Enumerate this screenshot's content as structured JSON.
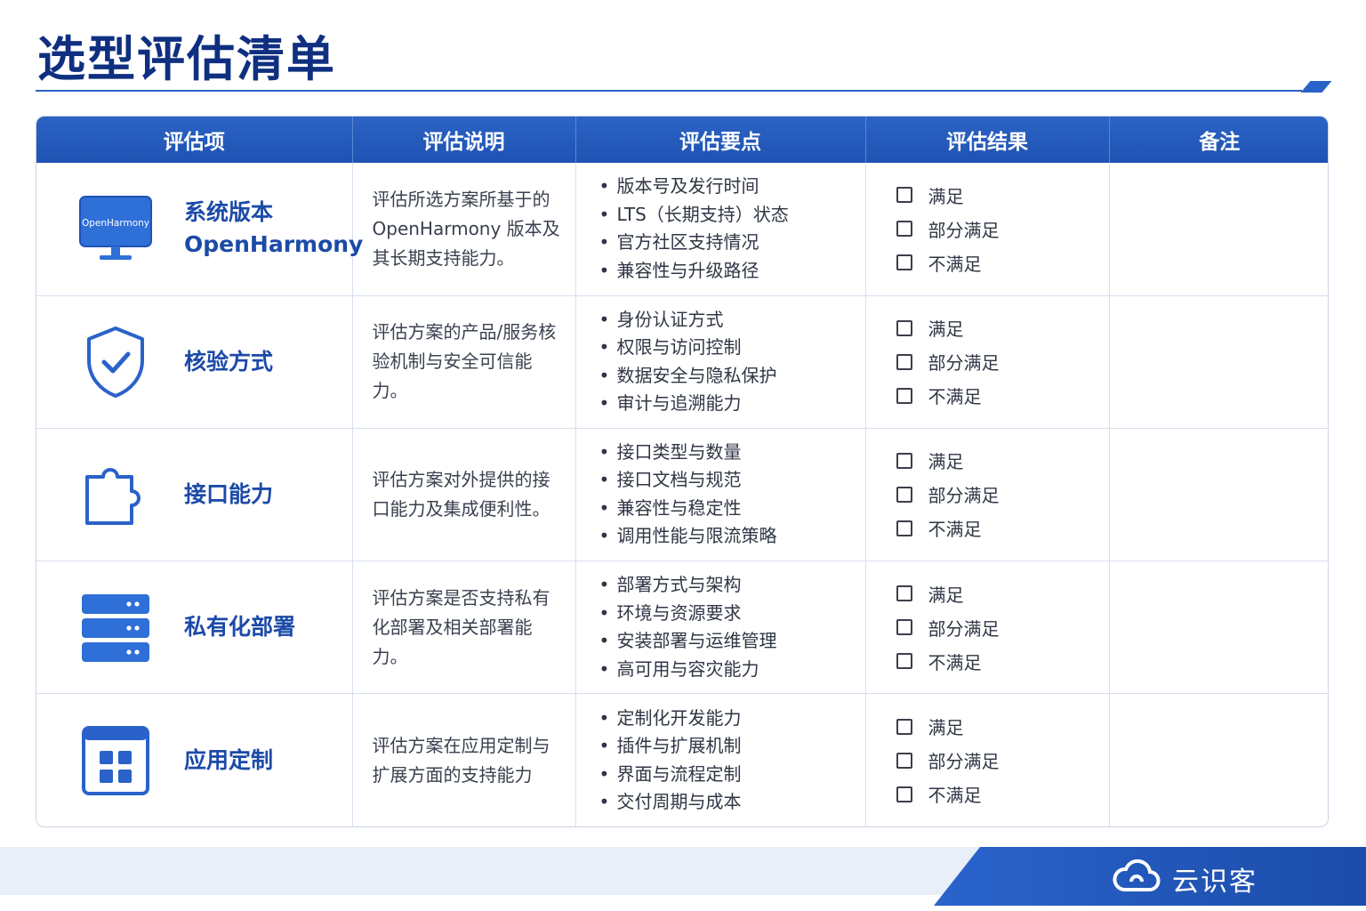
{
  "title": "选型评估清单",
  "table": {
    "headers": [
      "评估项",
      "评估说明",
      "评估要点",
      "评估结果",
      "备注"
    ],
    "result_options": [
      "满足",
      "部分满足",
      "不满足"
    ],
    "rows": [
      {
        "icon": "monitor-icon",
        "icon_text": "OpenHarmony",
        "name": "系统版本\nOpenHarmony",
        "description": "评估所选方案所基于的OpenHarmony 版本及其长期支持能力。",
        "points": [
          "版本号及发行时间",
          "LTS（长期支持）状态",
          "官方社区支持情况",
          "兼容性与升级路径"
        ],
        "remark": ""
      },
      {
        "icon": "shield-check-icon",
        "name": "核验方式",
        "description": "评估方案的产品/服务核验机制与安全可信能力。",
        "points": [
          "身份认证方式",
          "权限与访问控制",
          "数据安全与隐私保护",
          "审计与追溯能力"
        ],
        "remark": ""
      },
      {
        "icon": "puzzle-icon",
        "name": "接口能力",
        "description": "评估方案对外提供的接口能力及集成便利性。",
        "points": [
          "接口类型与数量",
          "接口文档与规范",
          "兼容性与稳定性",
          "调用性能与限流策略"
        ],
        "remark": ""
      },
      {
        "icon": "server-icon",
        "name": "私有化部署",
        "description": "评估方案是否支持私有化部署及相关部署能力。",
        "points": [
          "部署方式与架构",
          "环境与资源要求",
          "安装部署与运维管理",
          "高可用与容灾能力"
        ],
        "remark": ""
      },
      {
        "icon": "app-grid-icon",
        "name": "应用定制",
        "description": "评估方案在应用定制与扩展方面的支持能力",
        "points": [
          "定制化开发能力",
          "插件与扩展机制",
          "界面与流程定制",
          "交付周期与成本"
        ],
        "remark": ""
      }
    ]
  },
  "footer": {
    "brand_icon": "cloud-icon",
    "brand_name": "云识客"
  },
  "colors": {
    "primary": "#1f53b3",
    "title": "#0f2f80",
    "accent": "#2a62c9"
  }
}
